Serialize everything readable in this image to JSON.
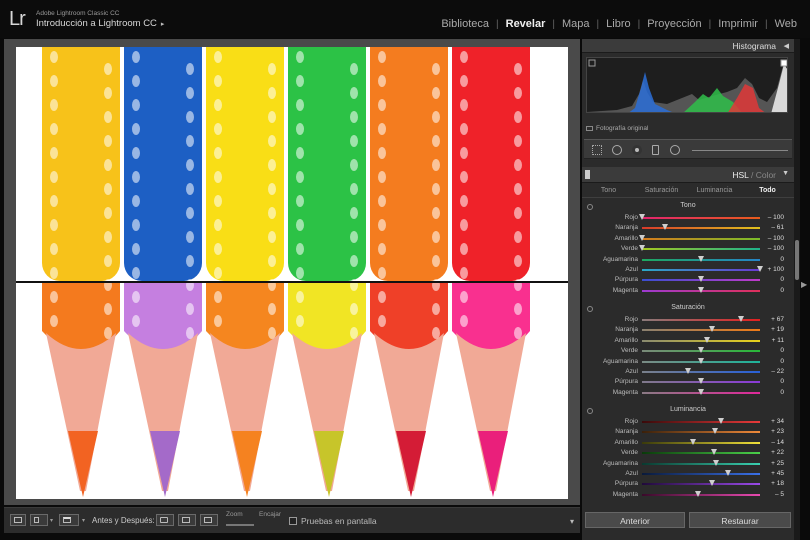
{
  "app": {
    "logo": "Lr",
    "subtitle": "Adobe Lightroom Classic CC",
    "catalog": "Introducción a Lightroom CC",
    "catalog_arrow": "▸"
  },
  "modules": [
    "Biblioteca",
    "Revelar",
    "Mapa",
    "Libro",
    "Proyección",
    "Imprimir",
    "Web"
  ],
  "active_module": "Revelar",
  "pencils": [
    {
      "top_color": "#f7c21a",
      "bottom_color": "#f47a1e",
      "tip_color": "#f26322"
    },
    {
      "top_color": "#1d5fc4",
      "bottom_color": "#c57fe0",
      "tip_color": "#a46ac9"
    },
    {
      "top_color": "#f9de16",
      "bottom_color": "#f5861f",
      "tip_color": "#f58220"
    },
    {
      "top_color": "#2cc246",
      "bottom_color": "#f1e524",
      "tip_color": "#c7c52a"
    },
    {
      "top_color": "#f47c1f",
      "bottom_color": "#ef4028",
      "tip_color": "#d41c36"
    },
    {
      "top_color": "#ef2229",
      "bottom_color": "#f9308f",
      "tip_color": "#ea1f7b"
    }
  ],
  "toolbar": {
    "before_after_label": "Antes y Después:",
    "zoom_label": "Zoom",
    "fit_label": "Encajar",
    "proof_label": "Pruebas en pantalla",
    "dropdown_arrow": "▾"
  },
  "histogram": {
    "title": "Histograma",
    "original_label": "Fotografía original"
  },
  "hsl": {
    "title_hsl": "HSL",
    "title_slash": " / ",
    "title_color": "Color",
    "tabs": [
      "Tono",
      "Saturación",
      "Luminancia",
      "Todo"
    ],
    "active_tab": "Todo",
    "sections": [
      {
        "title": "Tono",
        "rows": [
          {
            "label": "Rojo",
            "value": "– 100",
            "num": -100,
            "c1": "#e2246e",
            "c2": "#e85c1c"
          },
          {
            "label": "Naranja",
            "value": "– 61",
            "num": -61,
            "c1": "#d83a2b",
            "c2": "#e0c21d"
          },
          {
            "label": "Amarillo",
            "value": "– 100",
            "num": -100,
            "c1": "#d67b1c",
            "c2": "#7bbd2a"
          },
          {
            "label": "Verde",
            "value": "– 100",
            "num": -100,
            "c1": "#a5c71f",
            "c2": "#1eb38b"
          },
          {
            "label": "Aguamarina",
            "value": "0",
            "num": 0,
            "c1": "#1ea85f",
            "c2": "#2585c9"
          },
          {
            "label": "Azul",
            "value": "+ 100",
            "num": 100,
            "c1": "#2aa8c4",
            "c2": "#6a3ad2"
          },
          {
            "label": "Púrpura",
            "value": "0",
            "num": 0,
            "c1": "#3a4ed0",
            "c2": "#c03ac9"
          },
          {
            "label": "Magenta",
            "value": "0",
            "num": 0,
            "c1": "#9c3ad0",
            "c2": "#e0305a"
          }
        ]
      },
      {
        "title": "Saturación",
        "rows": [
          {
            "label": "Rojo",
            "value": "+ 67",
            "num": 67,
            "c1": "#8a7a7a",
            "c2": "#e22020"
          },
          {
            "label": "Naranja",
            "value": "+ 19",
            "num": 19,
            "c1": "#8a8070",
            "c2": "#ee7a16"
          },
          {
            "label": "Amarillo",
            "value": "+ 11",
            "num": 11,
            "c1": "#8a8a70",
            "c2": "#e8d21a"
          },
          {
            "label": "Verde",
            "value": "0",
            "num": 0,
            "c1": "#7a8a7a",
            "c2": "#28b838"
          },
          {
            "label": "Aguamarina",
            "value": "0",
            "num": 0,
            "c1": "#7a8a84",
            "c2": "#1eb49a"
          },
          {
            "label": "Azul",
            "value": "– 22",
            "num": -22,
            "c1": "#7a808a",
            "c2": "#2860d8"
          },
          {
            "label": "Púrpura",
            "value": "0",
            "num": 0,
            "c1": "#807a8a",
            "c2": "#8a3ad8"
          },
          {
            "label": "Magenta",
            "value": "0",
            "num": 0,
            "c1": "#8a7a84",
            "c2": "#e0289a"
          }
        ]
      },
      {
        "title": "Luminancia",
        "rows": [
          {
            "label": "Rojo",
            "value": "+ 34",
            "num": 34,
            "c1": "#3a0a0a",
            "c2": "#e83a3a"
          },
          {
            "label": "Naranja",
            "value": "+ 23",
            "num": 23,
            "c1": "#3a200a",
            "c2": "#f08a3a"
          },
          {
            "label": "Amarillo",
            "value": "– 14",
            "num": -14,
            "c1": "#3a3a0a",
            "c2": "#f0e03a"
          },
          {
            "label": "Verde",
            "value": "+ 22",
            "num": 22,
            "c1": "#0a3a0a",
            "c2": "#4ad04a"
          },
          {
            "label": "Aguamarina",
            "value": "+ 25",
            "num": 25,
            "c1": "#0a3a30",
            "c2": "#3ad0b0"
          },
          {
            "label": "Azul",
            "value": "+ 45",
            "num": 45,
            "c1": "#0a1a3a",
            "c2": "#3a70e8"
          },
          {
            "label": "Púrpura",
            "value": "+ 18",
            "num": 18,
            "c1": "#200a3a",
            "c2": "#9a4ae8"
          },
          {
            "label": "Magenta",
            "value": "– 5",
            "num": -5,
            "c1": "#3a0a2a",
            "c2": "#e84ab0"
          }
        ]
      }
    ]
  },
  "buttons": {
    "previous": "Anterior",
    "reset": "Restaurar"
  }
}
